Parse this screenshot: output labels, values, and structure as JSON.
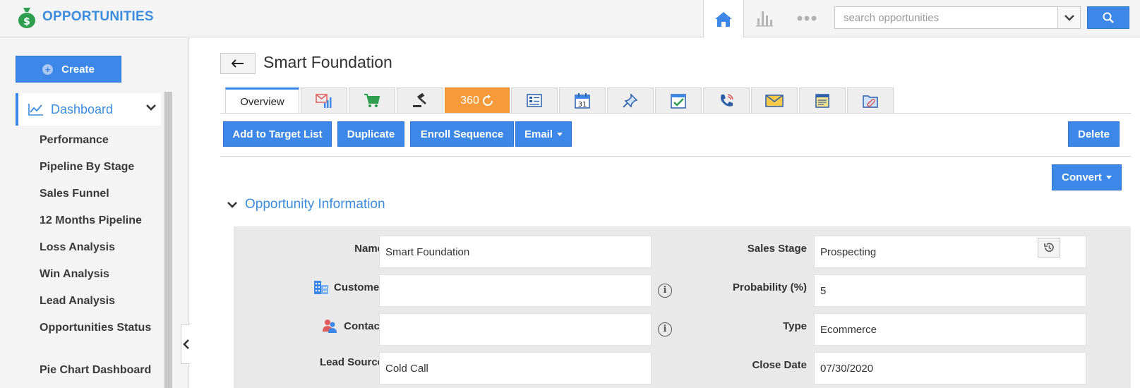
{
  "app": {
    "title": "OPPORTUNITIES"
  },
  "search": {
    "placeholder": "search opportunities"
  },
  "sidebar": {
    "create_label": "Create",
    "dashboard_label": "Dashboard",
    "items": [
      {
        "label": "Performance"
      },
      {
        "label": "Pipeline By Stage"
      },
      {
        "label": "Sales Funnel"
      },
      {
        "label": "12 Months Pipeline"
      },
      {
        "label": "Loss Analysis"
      },
      {
        "label": "Win Analysis"
      },
      {
        "label": "Lead Analysis"
      },
      {
        "label": "Opportunities Status"
      },
      {
        "label": "Pie Chart Dashboard"
      }
    ]
  },
  "record": {
    "title": "Smart Foundation"
  },
  "tabs": {
    "overview": "Overview",
    "t360": "360",
    "icons": [
      "email-report-icon",
      "cart-icon",
      "gavel-icon",
      "refresh-icon",
      "document-icon",
      "calendar-icon",
      "pin-icon",
      "task-icon",
      "call-icon",
      "mail-icon",
      "notes-icon",
      "attachment-icon"
    ],
    "calendar_day": "31"
  },
  "actions": {
    "add_to_target": "Add to Target List",
    "duplicate": "Duplicate",
    "enroll": "Enroll Sequence",
    "email": "Email",
    "delete": "Delete",
    "convert": "Convert"
  },
  "section": {
    "title": "Opportunity Information"
  },
  "fields": {
    "name": {
      "label": "Name",
      "value": "Smart Foundation"
    },
    "customer": {
      "label": "Customer",
      "value": ""
    },
    "contact": {
      "label": "Contact",
      "value": ""
    },
    "lead_source": {
      "label": "Lead Source",
      "value": "Cold Call"
    },
    "sales_stage": {
      "label": "Sales Stage",
      "value": "Prospecting"
    },
    "probability": {
      "label": "Probability (%)",
      "value": "5"
    },
    "type": {
      "label": "Type",
      "value": "Ecommerce"
    },
    "close_date": {
      "label": "Close Date",
      "value": "07/30/2020"
    }
  },
  "colors": {
    "accent": "#3d87e8",
    "brand_text": "#3c8dde",
    "tab_360": "#f79a3b",
    "brand_icon": "#2f9e4e"
  }
}
